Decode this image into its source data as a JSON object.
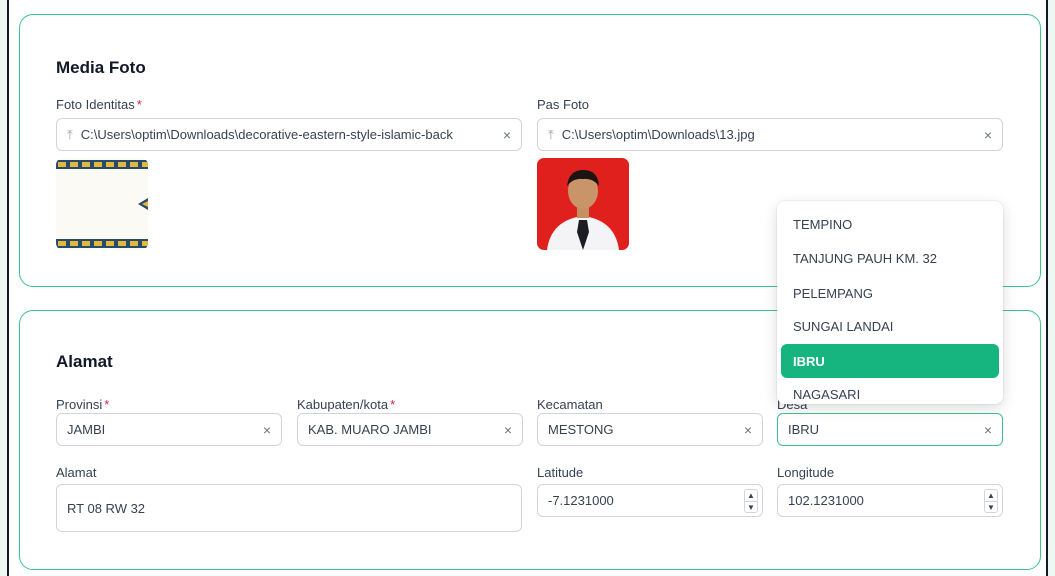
{
  "media": {
    "title": "Media Foto",
    "foto_identitas": {
      "label": "Foto Identitas",
      "required": "*",
      "value": "C:\\Users\\optim\\Downloads\\decorative-eastern-style-islamic-back"
    },
    "pas_foto": {
      "label": "Pas Foto",
      "value": "C:\\Users\\optim\\Downloads\\13.jpg"
    }
  },
  "alamat": {
    "title": "Alamat",
    "provinsi": {
      "label": "Provinsi",
      "required": "*",
      "value": "JAMBI"
    },
    "kabupaten": {
      "label": "Kabupaten/kota",
      "required": "*",
      "value": "KAB. MUARO JAMBI"
    },
    "kecamatan": {
      "label": "Kecamatan",
      "value": "MESTONG"
    },
    "desa": {
      "label": "Desa",
      "value": "IBRU"
    },
    "alamat": {
      "label": "Alamat",
      "value": "RT 08 RW 32"
    },
    "latitude": {
      "label": "Latitude",
      "value": "-7.1231000"
    },
    "longitude": {
      "label": "Longitude",
      "value": "102.1231000"
    }
  },
  "dropdown": {
    "options": [
      "TEMPINO",
      "TANJUNG PAUH KM. 32",
      "PELEMPANG",
      "SUNGAI LANDAI",
      "IBRU",
      "NAGASARI"
    ],
    "selected": "IBRU"
  },
  "icons": {
    "clear": "×",
    "upload": "⤒",
    "spin_up": "▲",
    "spin_down": "▼"
  },
  "colors": {
    "accent": "#16b57f",
    "border_accent": "#3cc48f",
    "required": "#e11d48"
  }
}
